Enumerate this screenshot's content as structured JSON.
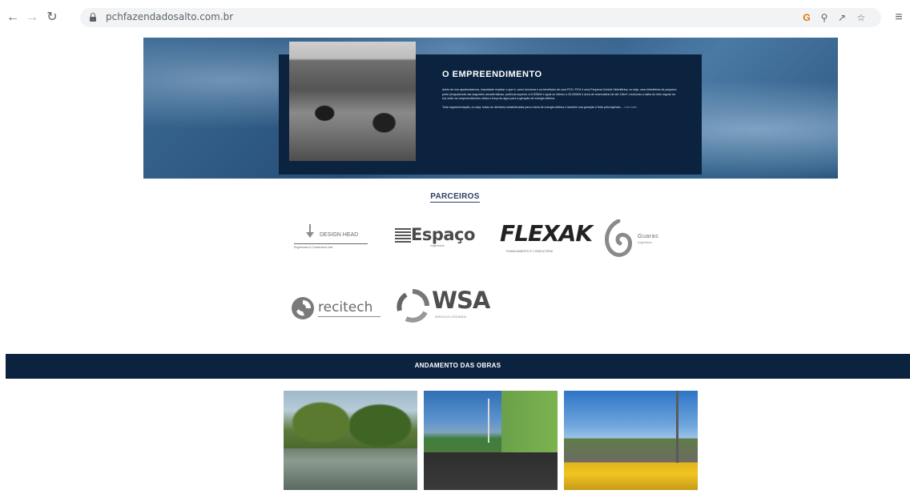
{
  "browser": {
    "back_icon": "arrow-left-icon",
    "forward_icon": "arrow-right-icon",
    "reload_icon": "reload-icon",
    "url": "pchfazendadosalto.com.br",
    "extension_icons": [
      "google-icon",
      "zoom-icon",
      "share-icon",
      "star-icon",
      "menu-icon"
    ]
  },
  "hero": {
    "title": "O EMPREENDIMENTO",
    "paragraph_1": "Antes de nos aprofundarmos, importante explicar o que é, como funciona e os benefícios de uma PCH. PCH é uma Pequena Central Hidrelétrica, ou seja, uma hidrelétrica de pequeno porte (enquadrada nas seguintes características: potência superior a 5.000kW e igual ou inferior a 30.000kW e área de reservatório de até 13km², excluindo a calha do leito regular do rio) onde um empreendimento utiliza a força da água para a geração de energia elétrica.",
    "paragraph_2": "Toda regulamentação, ou seja, todas as diretrizes estabelecidas para a área de energia elétrica e também sua geração é feita pela Agência ...",
    "read_more": "Leia mais",
    "panel_color": "#0c2340"
  },
  "partners": {
    "title": "PARCEIROS",
    "logos": [
      {
        "name": "DESIGN HEAD",
        "subtitle": "Engenharia & Construtora Ltda"
      },
      {
        "name": "Espaço",
        "subtitle": "engenharia"
      },
      {
        "name": "FLEXAK",
        "subtitle": "FINANCIAMENTO E CONSULTORIA"
      },
      {
        "name": "Guaras",
        "subtitle": "engenharia"
      },
      {
        "name": "recitech"
      },
      {
        "name": "WSA",
        "subtitle": "SERVIÇOS CONTÁBEIS"
      }
    ]
  },
  "progress": {
    "title": "ANDAMENTO DAS OBRAS",
    "band_color": "#0c2340",
    "photos": [
      "construction-photo-river",
      "construction-photo-building",
      "construction-photo-spillway"
    ]
  }
}
